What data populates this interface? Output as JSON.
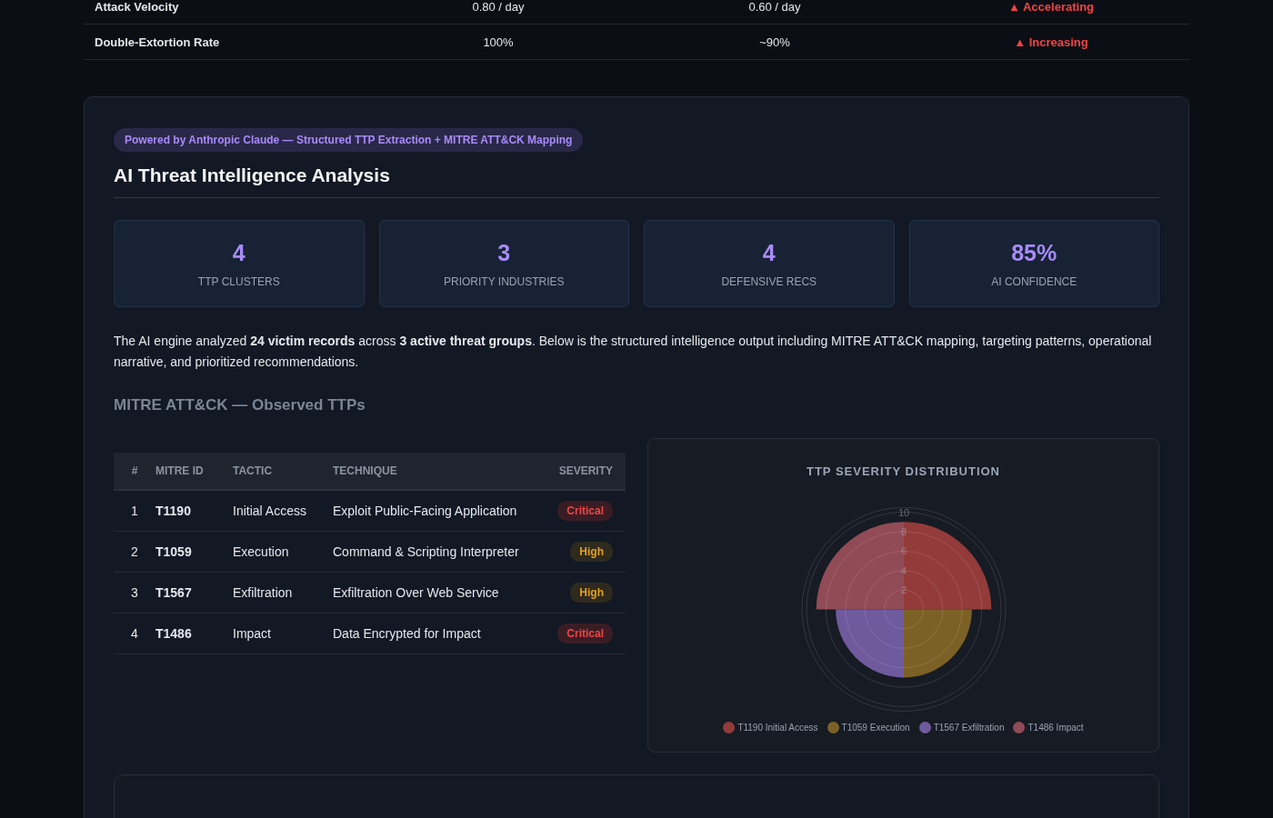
{
  "trend_table": {
    "rows": [
      {
        "metric": "Attack Velocity",
        "value_1": "0.80 / day",
        "value_2": "0.60 / day",
        "trend": "▲ Accelerating"
      },
      {
        "metric": "Double-Extortion Rate",
        "value_1": "100%",
        "value_2": "~90%",
        "trend": "▲ Increasing"
      }
    ]
  },
  "analysis": {
    "badge": "Powered by Anthropic Claude — Structured TTP Extraction + MITRE ATT&CK Mapping",
    "title": "AI Threat Intelligence Analysis",
    "stats": [
      {
        "value": "4",
        "label": "TTP CLUSTERS"
      },
      {
        "value": "3",
        "label": "PRIORITY INDUSTRIES"
      },
      {
        "value": "4",
        "label": "DEFENSIVE RECS"
      },
      {
        "value": "85%",
        "label": "AI CONFIDENCE"
      }
    ],
    "summary": "The AI engine analyzed **24 victim records** across **3 active threat groups**. Below is the structured intelligence output including MITRE ATT&CK mapping, targeting patterns, operational narrative, and prioritized recommendations.",
    "ttp_heading": "MITRE ATT&CK — Observed TTPs",
    "ttp_table": {
      "columns": [
        "#",
        "MITRE ID",
        "TACTIC",
        "TECHNIQUE",
        "SEVERITY"
      ],
      "rows": [
        {
          "num": "1",
          "id": "T1190",
          "tactic": "Initial Access",
          "technique": "Exploit Public-Facing Application",
          "severity": "Critical",
          "kind": "critical"
        },
        {
          "num": "2",
          "id": "T1059",
          "tactic": "Execution",
          "technique": "Command & Scripting Interpreter",
          "severity": "High",
          "kind": "high"
        },
        {
          "num": "3",
          "id": "T1567",
          "tactic": "Exfiltration",
          "technique": "Exfiltration Over Web Service",
          "severity": "High",
          "kind": "high"
        },
        {
          "num": "4",
          "id": "T1486",
          "tactic": "Impact",
          "technique": "Data Encrypted for Impact",
          "severity": "Critical",
          "kind": "critical"
        }
      ]
    },
    "chart_panel": {
      "title": "TTP SEVERITY DISTRIBUTION",
      "radial_ticks": [
        "10",
        "8",
        "6",
        "4",
        "2"
      ],
      "slices": [
        {
          "level": 0.9,
          "color": "#933b3b"
        },
        {
          "level": 0.7,
          "color": "#7c6126"
        },
        {
          "level": 0.7,
          "color": "#6f5a9e"
        },
        {
          "level": 0.9,
          "color": "#914b56"
        }
      ],
      "legend": [
        {
          "label": "T1190 Initial Access",
          "color": "#933b3b"
        },
        {
          "label": "T1059 Execution",
          "color": "#7c6126"
        },
        {
          "label": "T1567 Exfiltration",
          "color": "#6f5a9e"
        },
        {
          "label": "T1486 Impact",
          "color": "#914b56"
        }
      ]
    }
  }
}
